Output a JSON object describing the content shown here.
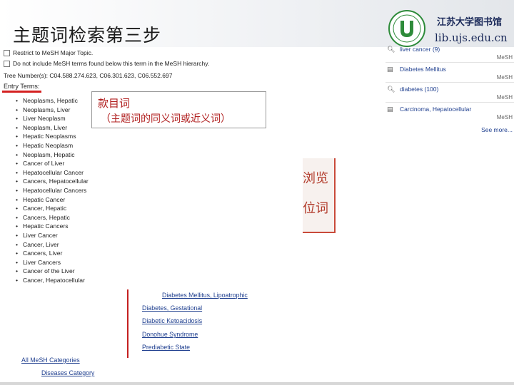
{
  "header": {
    "title": "主题词检索第三步",
    "library_name": "江苏大学图书馆",
    "library_url": "lib.ujs.edu.cn"
  },
  "options": {
    "restrict_major": "Restrict to MeSH Major Topic.",
    "no_explode": "Do not include MeSH terms found below this term in the MeSH hierarchy."
  },
  "tree_numbers": "Tree Number(s): C04.588.274.623, C06.301.623, C06.552.697",
  "entry_terms_heading": "Entry Terms:",
  "entry_terms": [
    "Neoplasms, Hepatic",
    "Neoplasms, Liver",
    "Liver Neoplasm",
    "Neoplasm, Liver",
    "Hepatic Neoplasms",
    "Hepatic Neoplasm",
    "Neoplasm, Hepatic",
    "Cancer of Liver",
    "Hepatocellular Cancer",
    "Cancers, Hepatocellular",
    "Hepatocellular Cancers",
    "Hepatic Cancer",
    "Cancer, Hepatic",
    "Cancers, Hepatic",
    "Hepatic Cancers",
    "Liver Cancer",
    "Cancer, Liver",
    "Cancers, Liver",
    "Liver Cancers",
    "Cancer of the Liver",
    "Cancer, Hepatocellular"
  ],
  "callout": {
    "line1": "款目词",
    "line2": "（主题词的同义词或近义词）"
  },
  "side_box": {
    "text1": "浏览",
    "text2": "位词"
  },
  "recent_activity": {
    "items": [
      {
        "icon": "search-icon",
        "text": "liver cancer (9)",
        "tag": "MeSH"
      },
      {
        "icon": "document-icon",
        "text": "Diabetes Mellitus",
        "tag": "MeSH"
      },
      {
        "icon": "search-icon",
        "text": "diabetes (100)",
        "tag": "MeSH"
      },
      {
        "icon": "document-icon",
        "text": "Carcinoma, Hepatocellular",
        "tag": "MeSH"
      }
    ],
    "see_more": "See more..."
  },
  "tree_links": [
    "Diabetes Mellitus, Lipoatrophic",
    "Diabetes, Gestational",
    "Diabetic Ketoacidosis",
    "Donohue Syndrome",
    "Prediabetic State"
  ],
  "category_links": {
    "all": "All MeSH Categories",
    "diseases": "Diseases Category"
  }
}
